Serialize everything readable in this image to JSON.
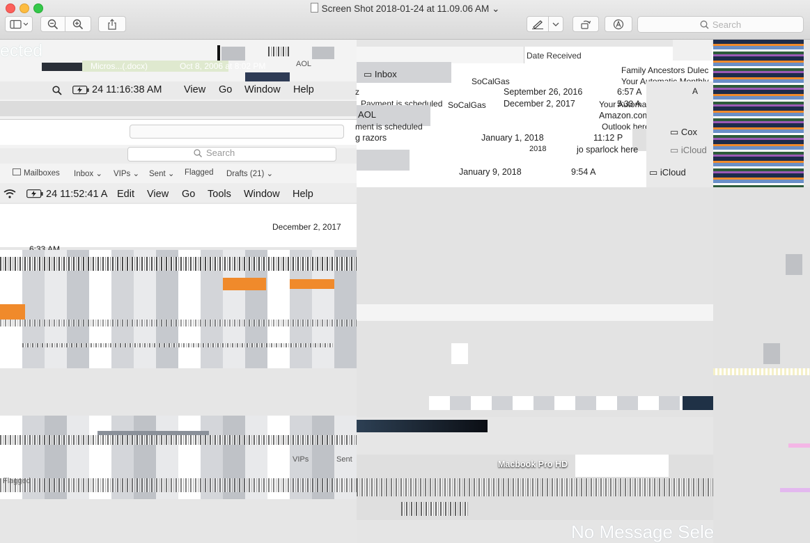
{
  "window": {
    "title": "Screen Shot 2018-01-24 at 11.09.06 AM",
    "title_chevron": "⌄",
    "search_placeholder": "Search"
  },
  "toolbar": {
    "sidebar_icon": "sidebar-icon",
    "zoom_out_icon": "zoom-out-icon",
    "zoom_in_icon": "zoom-in-icon",
    "share_icon": "share-icon",
    "markup_icon": "pen-icon",
    "rotate_icon": "rotate-icon",
    "annotate_icon": "annotate-icon"
  },
  "fragments": {
    "selected_text": "ected",
    "doc_name": "Micros...(.docx)",
    "doc_date": "Oct 8, 2006 at 8:02 PM",
    "aol_small": "AOL",
    "menubar1": {
      "clock": "24  11:16:38 AM",
      "items": [
        "View",
        "Go",
        "Window",
        "Help"
      ]
    },
    "search2": "Search",
    "mailbar": {
      "mailboxes": "Mailboxes",
      "inbox": "Inbox",
      "vips": "VIPs",
      "sent": "Sent",
      "flagged": "Flagged",
      "drafts": "Drafts (21)"
    },
    "menubar2": {
      "clock": "24  11:52:41 A",
      "items": [
        "Edit",
        "View",
        "Go",
        "Tools",
        "Window",
        "Help"
      ]
    },
    "left_date": "December 2, 2017",
    "left_time": "6:33 AM",
    "bottom_vips": "VIPs",
    "bottom_sent": "Sent",
    "bottom_flagged": "Flagged",
    "mail": {
      "date_received": "Date Received",
      "inbox": "Inbox",
      "socalgas": "SoCalGas",
      "socalgas2": "SoCalGas",
      "payment1": "Payment is scheduled",
      "payment2": "ment is scheduled",
      "z": "z",
      "date1": "September 26, 2016",
      "time1": "6:57 A",
      "date2": "December 2, 2017",
      "time2": "5:33 A",
      "aol": "AOL",
      "razors": "g razors",
      "date3": "January 1, 2018",
      "time3": "11:12 P",
      "date4": "January 9, 2018",
      "time4": "9:54 A",
      "date4b": "2018",
      "subj1": "Family Ancestors Dulec",
      "subj2": "Your Automatic Monthly",
      "subj3": "Your Automatic Monthly Pay",
      "subj4": "Amazon.com: electric shavin",
      "subj5": "Outlook here",
      "subj6": "jo sparlock here",
      "cox": "Cox",
      "icloud": "iCloud",
      "icloud2": "iCloud",
      "letter_a": "A"
    },
    "macbook": "Macbook Pro HD",
    "no_message": "No Message Sele"
  }
}
